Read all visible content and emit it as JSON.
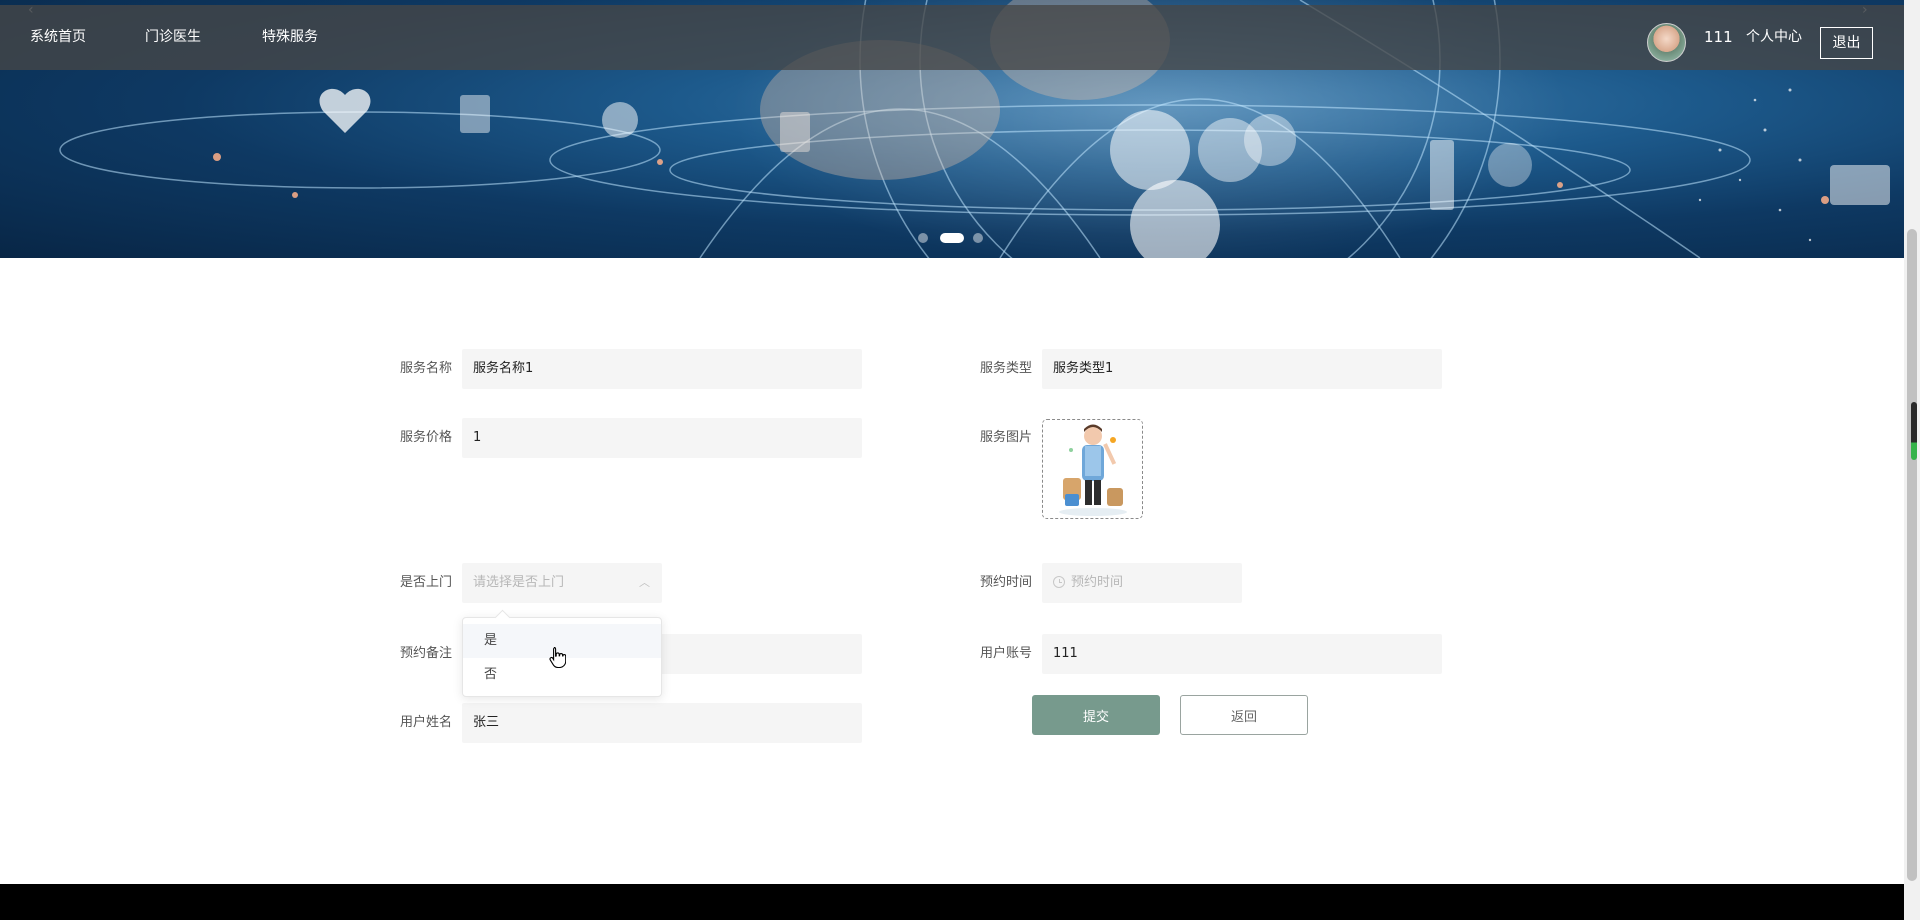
{
  "nav": {
    "items": [
      {
        "label": "系统首页"
      },
      {
        "label": "门诊医生"
      },
      {
        "label": "特殊服务"
      }
    ],
    "user_name": "111",
    "user_center": "个人中心",
    "logout": "退出"
  },
  "banner": {
    "slide_count": 3,
    "active_slide": 2
  },
  "form": {
    "service_name": {
      "label": "服务名称",
      "value": "服务名称1"
    },
    "service_type": {
      "label": "服务类型",
      "value": "服务类型1"
    },
    "service_price": {
      "label": "服务价格",
      "value": "1"
    },
    "service_image": {
      "label": "服务图片"
    },
    "home_visit": {
      "label": "是否上门",
      "placeholder": "请选择是否上门",
      "options": [
        "是",
        "否"
      ]
    },
    "appointment_time": {
      "label": "预约时间",
      "placeholder": "预约时间"
    },
    "appointment_note": {
      "label": "预约备注",
      "value": ""
    },
    "user_account": {
      "label": "用户账号",
      "value": "111"
    },
    "user_fullname": {
      "label": "用户姓名",
      "value": "张三"
    },
    "submit": "提交",
    "back": "返回"
  },
  "colors": {
    "submit_bg": "#779a8d",
    "nav_bg": "#464646",
    "footer": "#000000"
  }
}
